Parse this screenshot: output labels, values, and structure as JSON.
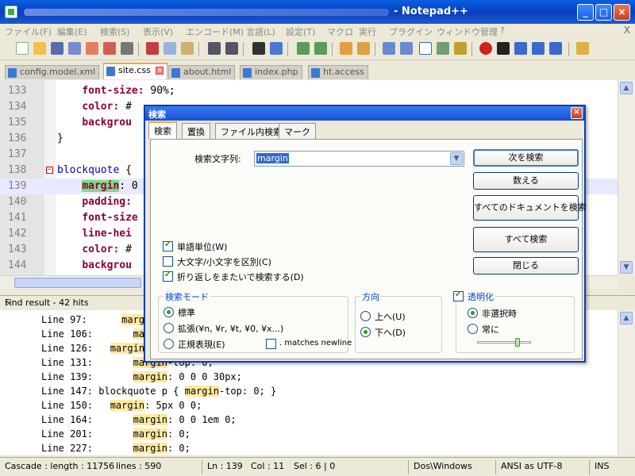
{
  "window": {
    "title": "- Notepad++",
    "minimize_glyph": "_",
    "maximize_glyph": "□",
    "close_glyph": "×"
  },
  "menu": [
    "ファイル(F)",
    "編集(E)",
    "検索(S)",
    "表示(V)",
    "エンコード(M)",
    "言語(L)",
    "設定(T)",
    "マクロ",
    "実行",
    "プラグイン",
    "ウィンドウ管理",
    "?"
  ],
  "menu_close": "X",
  "tabs": [
    {
      "label": "config.model.xml",
      "active": false
    },
    {
      "label": "site.css",
      "active": true
    },
    {
      "label": "about.html",
      "active": false
    },
    {
      "label": "index.php",
      "active": false
    },
    {
      "label": "ht.access",
      "active": false
    }
  ],
  "editor": {
    "line_numbers": [
      "133",
      "134",
      "135",
      "136",
      "137",
      "138",
      "139",
      "140",
      "141",
      "142",
      "143",
      "144"
    ],
    "lines": {
      "l133_prop": "font-size: ",
      "l133_val": "90%;",
      "l134_prop": "color: ",
      "l134_val": "#",
      "l135_prop": "backgrou",
      "l136": "}",
      "l138_sel": "blockquote",
      "l138_rest": " {",
      "l139_match": "margin",
      "l139_rest": ": 0",
      "l140_prop": "padding: ",
      "l141_prop": "font-size",
      "l142_prop": "line-hei",
      "l143_prop": "color: ",
      "l143_val": "#",
      "l144_prop": "backgrou"
    }
  },
  "find_result": {
    "header": "Find result - 42 hits",
    "close_glyph": "×",
    "lines": [
      {
        "prefix": "Line 97:      ",
        "match": "margin",
        "suffix": ""
      },
      {
        "prefix": "Line 106:       ",
        "match": "margin",
        "suffix": ""
      },
      {
        "prefix": "Line 126:   ",
        "match": "margin",
        "suffix": ""
      },
      {
        "prefix": "Line 131:       ",
        "match": "margin",
        "suffix": "-top: 0;"
      },
      {
        "prefix": "Line 139:       ",
        "match": "margin",
        "suffix": ": 0 0 0 30px;"
      },
      {
        "prefix": "Line 147: blockquote p { ",
        "match": "margin",
        "suffix": "-top: 0; }"
      },
      {
        "prefix": "Line 150:   ",
        "match": "margin",
        "suffix": ": 5px 0 0;"
      },
      {
        "prefix": "Line 164:       ",
        "match": "margin",
        "suffix": ": 0 0 1em 0;"
      },
      {
        "prefix": "Line 201:       ",
        "match": "margin",
        "suffix": ": 0;"
      },
      {
        "prefix": "Line 227:       ",
        "match": "margin",
        "suffix": ": 0;"
      }
    ]
  },
  "status": {
    "cascade": "Cascade : length : 11756",
    "lines": "lines : 590",
    "ln": "Ln : 139",
    "col": "Col : 11",
    "sel": "Sel : 6 | 0",
    "eol": "Dos\\Windows",
    "encoding": "ANSI as UTF-8",
    "ins": "INS"
  },
  "dialog": {
    "title": "検索",
    "close_glyph": "×",
    "tabs": [
      "検索",
      "置換",
      "ファイル内検索",
      "マーク"
    ],
    "find_label": "検索文字列:",
    "find_value": "margin",
    "buttons": {
      "find_next": "次を検索",
      "count": "数える",
      "find_all_docs": "すべてのドキュメントを検索",
      "find_all": "すべて検索",
      "close": "閉じる"
    },
    "options": {
      "whole_word": "単語単位(W)",
      "match_case": "大文字/小文字を区別(C)",
      "wrap_around": "折り返しをまたいで検索する(D)"
    },
    "search_mode": {
      "title": "検索モード",
      "normal": "標準",
      "extended": "拡張(¥n, ¥r, ¥t, ¥0, ¥x...)",
      "regex": "正規表現(E)",
      "matches_newline": ". matches newline"
    },
    "direction": {
      "title": "方向",
      "up": "上へ(U)",
      "down": "下へ(D)"
    },
    "transparency": {
      "label": "透明化",
      "on_losing_focus": "非選択時",
      "always": "常に",
      "level": 0.75
    }
  }
}
